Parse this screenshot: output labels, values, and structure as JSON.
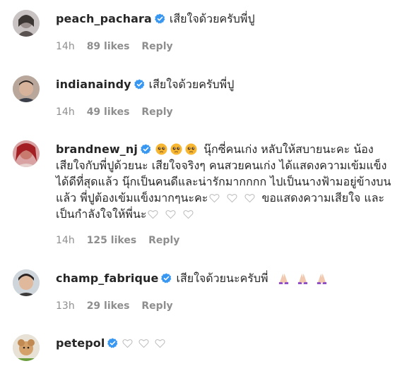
{
  "comments": [
    {
      "username": "peach_pachara",
      "text": "เสียใจด้วยครับพี่ปู",
      "time": "14h",
      "likes": "89 likes",
      "reply": "Reply"
    },
    {
      "username": "indianaindy",
      "text": "เสียใจด้วยครับพี่ปู",
      "time": "14h",
      "likes": "49 likes",
      "reply": "Reply"
    },
    {
      "username": "brandnew_nj",
      "text_lines": [
        "นุ๊กซี่คนเก่ง หลับให้สบายนะคะ น้อง",
        "เสียใจกับพี่ปูด้วยนะ เสียใจจริงๆ คนสวยคนเก่ง ได้แสดงความเข้มแข็ง",
        "ได้ดีที่สุดแล้ว นุ๊กเป็นคนดีและน่ารักมากกกก ไปเป็นนางฟ้ามอยู่ข้างบน",
        "แล้ว พี่ปูต้องเข้มแข็งมากๆนะคะ",
        "ขอแสดงความเสียใจ และ",
        "เป็นกำลังใจให้พี่นะ"
      ],
      "time": "14h",
      "likes": "125 likes",
      "reply": "Reply"
    },
    {
      "username": "champ_fabrique",
      "text": "เสียใจด้วยนะครับพี่",
      "time": "13h",
      "likes": "29 likes",
      "reply": "Reply"
    },
    {
      "username": "petepol",
      "text": "",
      "time": "",
      "likes": "",
      "reply": ""
    }
  ],
  "icons": {
    "verified": "verified-badge-icon",
    "emoji_sad": "pleading-face-emoji",
    "emoji_pray": "folded-hands-emoji",
    "heart": "white-heart-icon"
  },
  "colors": {
    "verified_blue": "#3897f0",
    "meta_gray": "#8e8e8e",
    "text": "#262626"
  }
}
